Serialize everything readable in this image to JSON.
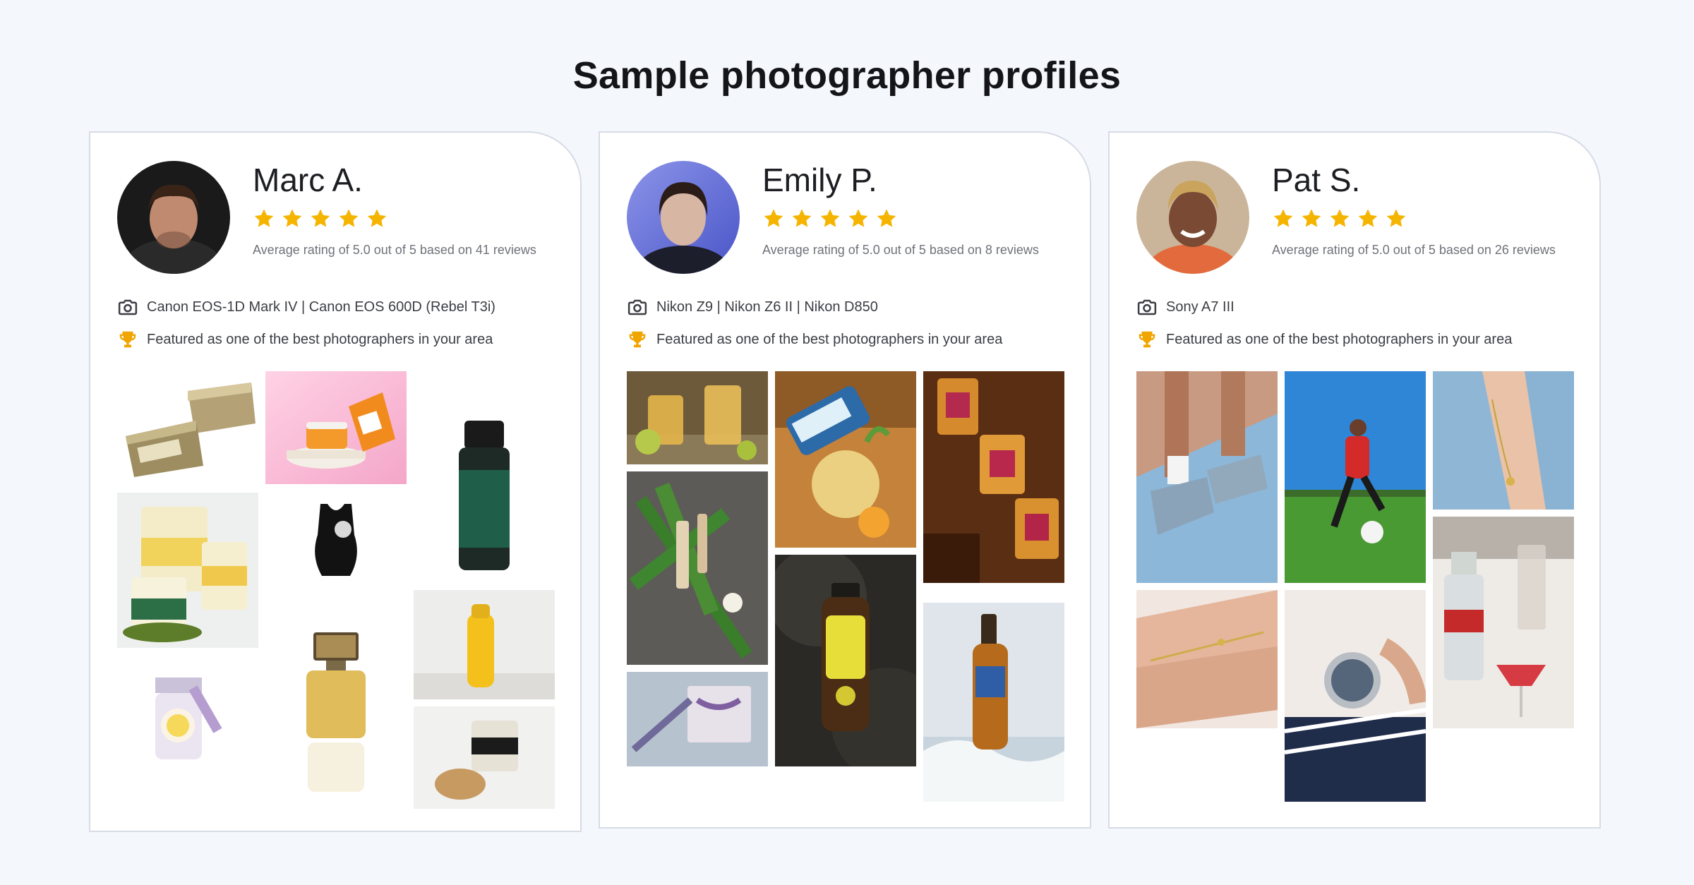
{
  "title": "Sample photographer profiles",
  "colors": {
    "star": "#f5b400",
    "trophy": "#f0a500",
    "border": "#d6dbe5",
    "background": "#f4f7fc"
  },
  "icons": {
    "camera": "camera-icon",
    "trophy": "trophy-icon",
    "star": "star-icon"
  },
  "profiles": [
    {
      "name": "Marc A.",
      "rating_text": "Average rating of 5.0 out of 5 based on 41 reviews",
      "stars": 5,
      "cameras": "Canon EOS-1D Mark IV | Canon EOS 600D (Rebel T3i)",
      "featured": "Featured as one of the best photographers in your area"
    },
    {
      "name": "Emily P.",
      "rating_text": "Average rating of 5.0 out of 5 based on 8 reviews",
      "stars": 5,
      "cameras": "Nikon Z9 | Nikon Z6 II | Nikon D850",
      "featured": "Featured as one of the best photographers in your area"
    },
    {
      "name": "Pat S.",
      "rating_text": "Average rating of 5.0 out of 5 based on 26 reviews",
      "stars": 5,
      "cameras": "Sony A7 III",
      "featured": "Featured as one of the best photographers in your area"
    }
  ]
}
